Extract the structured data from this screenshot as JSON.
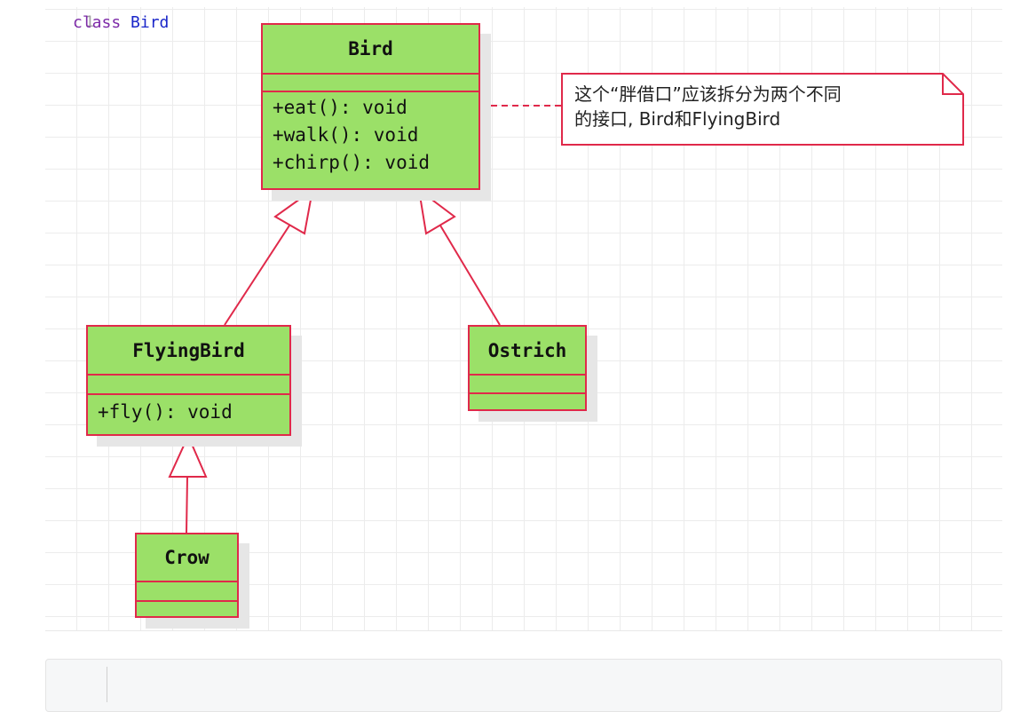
{
  "classes": {
    "bird": {
      "name": "Bird",
      "methods": [
        "+eat(): void",
        "+walk(): void",
        "+chirp(): void"
      ]
    },
    "flying_bird": {
      "name": "FlyingBird",
      "methods": [
        "+fly(): void"
      ]
    },
    "ostrich": {
      "name": "Ostrich",
      "methods": []
    },
    "crow": {
      "name": "Crow",
      "methods": []
    }
  },
  "note": {
    "text": "这个“胖借口”应该拆分为两个不同\n的接口, Bird和FlyingBird"
  },
  "relations": [
    {
      "type": "inheritance",
      "from": "FlyingBird",
      "to": "Bird"
    },
    {
      "type": "inheritance",
      "from": "Ostrich",
      "to": "Bird"
    },
    {
      "type": "inheritance",
      "from": "Crow",
      "to": "FlyingBird"
    },
    {
      "type": "note-link",
      "from": "note",
      "to": "Bird"
    }
  ],
  "code": {
    "line_number": "1",
    "keyword": "class",
    "class_name": "Bird"
  },
  "colors": {
    "class_fill": "#9be068",
    "stroke": "#e0294a",
    "note_fill": "#ffffff",
    "grid": "#ececec"
  }
}
